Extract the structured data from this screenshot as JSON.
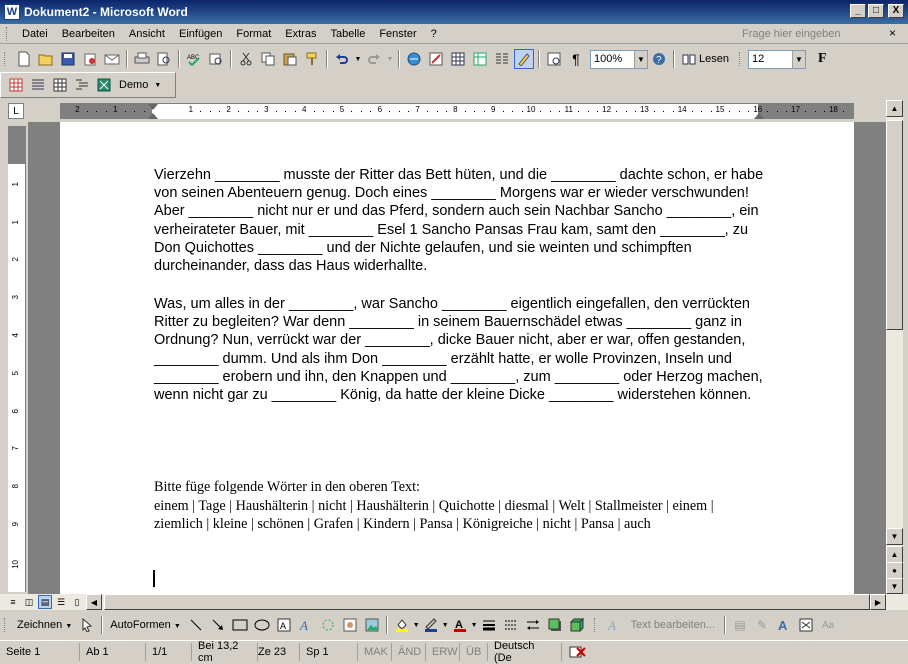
{
  "window": {
    "title": "Dokument2 - Microsoft Word",
    "app_icon_letter": "W",
    "controls": {
      "minimize": "_",
      "maximize": "□",
      "close": "X"
    }
  },
  "menubar": {
    "items": [
      "Datei",
      "Bearbeiten",
      "Ansicht",
      "Einfügen",
      "Format",
      "Extras",
      "Tabelle",
      "Fenster",
      "?"
    ],
    "help_placeholder": "Frage hier eingeben",
    "doc_close": "×"
  },
  "standard_toolbar": {
    "zoom": "100%",
    "read_button": "Lesen"
  },
  "formatting_toolbar": {
    "font_size": "12",
    "bold_glyph": "F"
  },
  "secondary_toolbar": {
    "demo_label": "Demo"
  },
  "ruler": {
    "ticks": [
      "2",
      "1",
      "1",
      "2",
      "3",
      "4",
      "5",
      "6",
      "7",
      "8",
      "9",
      "10",
      "11",
      "12",
      "13",
      "14",
      "15",
      "16",
      "17",
      "18"
    ],
    "vticks": [
      "1",
      "1",
      "2",
      "3",
      "4",
      "5",
      "6",
      "7",
      "8",
      "9",
      "10",
      "11"
    ]
  },
  "document": {
    "paragraph1": "Vierzehn ________ musste der Ritter das Bett hüten, und die ________ dachte schon, er habe von seinen Abenteuern genug. Doch eines ________ Morgens war er wieder verschwunden! Aber ________ nicht nur er und das Pferd, sondern auch sein Nachbar Sancho ________, ein verheirateter Bauer, mit ________ Esel 1 Sancho Pansas Frau kam, samt den ________, zu Don Quichottes ________ und der Nichte gelaufen, und sie weinten und schimpften durcheinander, dass das Haus widerhallte.",
    "paragraph2": "Was, um alles in der ________, war Sancho ________ eigentlich eingefallen, den verrückten Ritter zu begleiten? War denn ________ in seinem Bauernschädel etwas ________ ganz in Ordnung? Nun, verrückt war der ________, dicke Bauer nicht, aber er war, offen gestanden, ________ dumm. Und als ihm Don ________ erzählt hatte, er wolle Provinzen, Inseln und ________ erobern und ihn, den Knappen und ________, zum ________ oder Herzog machen, wenn nicht gar zu ________ König, da hatte der kleine Dicke ________ widerstehen können.",
    "instruction": "Bitte füge folgende Wörter in den oberen Text:",
    "word_list": "einem | Tage | Haushälterin | nicht | Haushälterin | Quichotte | diesmal | Welt | Stallmeister | einem | ziemlich | kleine | schönen | Grafen | Kindern | Pansa | Königreiche | nicht | Pansa | auch"
  },
  "drawing_toolbar": {
    "draw_menu": "Zeichnen",
    "autoshapes_menu": "AutoFormen",
    "text_edit": "Text bearbeiten..."
  },
  "statusbar": {
    "page": "Seite 1",
    "section": "Ab 1",
    "page_of": "1/1",
    "position": "Bei 13,2 cm",
    "line": "Ze 23",
    "column": "Sp 1",
    "mak": "MAK",
    "and": "ÄND",
    "erw": "ERW",
    "ub": "ÜB",
    "language": "Deutsch (De"
  }
}
